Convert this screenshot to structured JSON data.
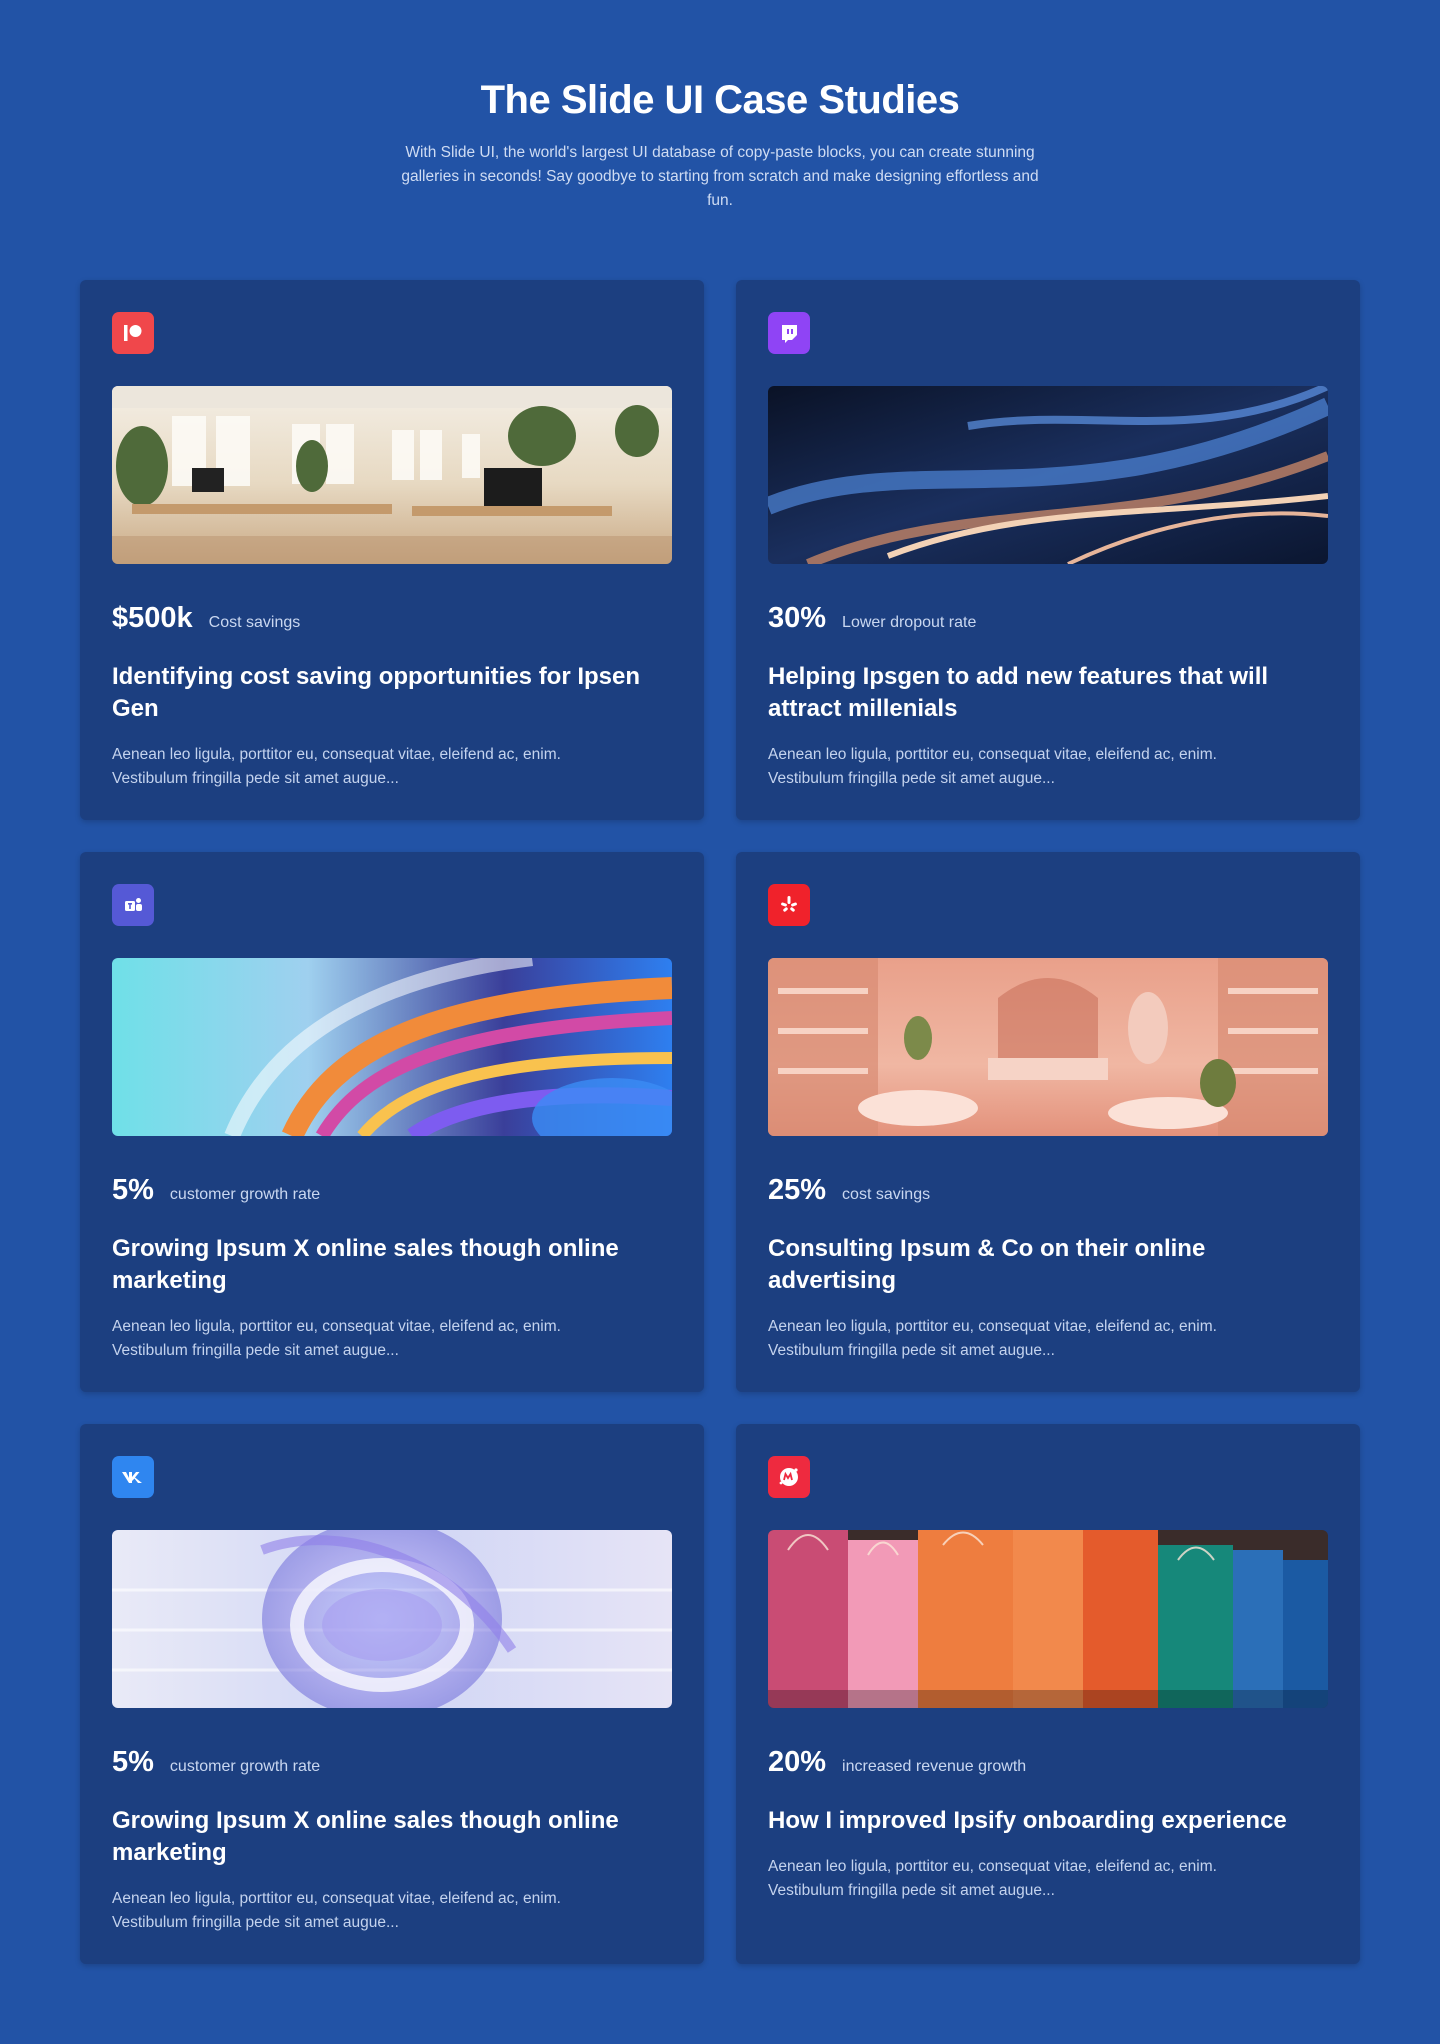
{
  "header": {
    "title": "The Slide UI Case Studies",
    "subtitle": "With Slide UI, the world's largest UI database of copy-paste blocks, you can create stunning galleries in seconds! Say goodbye to starting from scratch and make designing effortless and fun."
  },
  "cards": [
    {
      "logo_icon": "patreon-icon",
      "logo_color": "#f0474b",
      "image": "office-interior-image",
      "stat_value": "$500k",
      "stat_label": "Cost savings",
      "title": "Identifying cost saving opportunities for Ipsen Gen",
      "description": "Aenean leo ligula, porttitor eu, consequat vitae, eleifend ac, enim. Vestibulum fringilla pede sit amet augue..."
    },
    {
      "logo_icon": "twitch-icon",
      "logo_color": "#8f44f5",
      "image": "abstract-light-streaks-image",
      "stat_value": "30%",
      "stat_label": "Lower dropout rate",
      "title": "Helping Ipsgen to add new features that will attract millenials",
      "description": "Aenean leo ligula, porttitor eu, consequat vitae, eleifend ac, enim. Vestibulum fringilla pede sit amet augue..."
    },
    {
      "logo_icon": "teams-icon",
      "logo_color": "#5559d6",
      "image": "abstract-rainbow-swirl-image",
      "stat_value": "5%",
      "stat_label": "customer growth rate",
      "title": "Growing Ipsum X online sales though online marketing",
      "description": "Aenean leo ligula, porttitor eu, consequat vitae, eleifend ac, enim. Vestibulum fringilla pede sit amet augue..."
    },
    {
      "logo_icon": "yelp-icon",
      "logo_color": "#f0222b",
      "image": "pink-store-interior-image",
      "stat_value": "25%",
      "stat_label": "cost savings",
      "title": "Consulting Ipsum & Co on their online advertising",
      "description": "Aenean leo ligula, porttitor eu, consequat vitae, eleifend ac, enim. Vestibulum fringilla pede sit amet augue..."
    },
    {
      "logo_icon": "vk-icon",
      "logo_color": "#2f86f0",
      "image": "glass-swirl-image",
      "stat_value": "5%",
      "stat_label": "customer growth rate",
      "title": "Growing Ipsum X online sales though online marketing",
      "description": "Aenean leo ligula, porttitor eu, consequat vitae, eleifend ac, enim. Vestibulum fringilla pede sit amet augue..."
    },
    {
      "logo_icon": "meetup-icon",
      "logo_color": "#ee2a3f",
      "image": "shopping-bags-image",
      "stat_value": "20%",
      "stat_label": "increased revenue growth",
      "title": "How I improved Ipsify onboarding experience",
      "description": "Aenean leo ligula, porttitor eu, consequat vitae, eleifend ac, enim. Vestibulum fringilla pede sit amet augue..."
    }
  ]
}
